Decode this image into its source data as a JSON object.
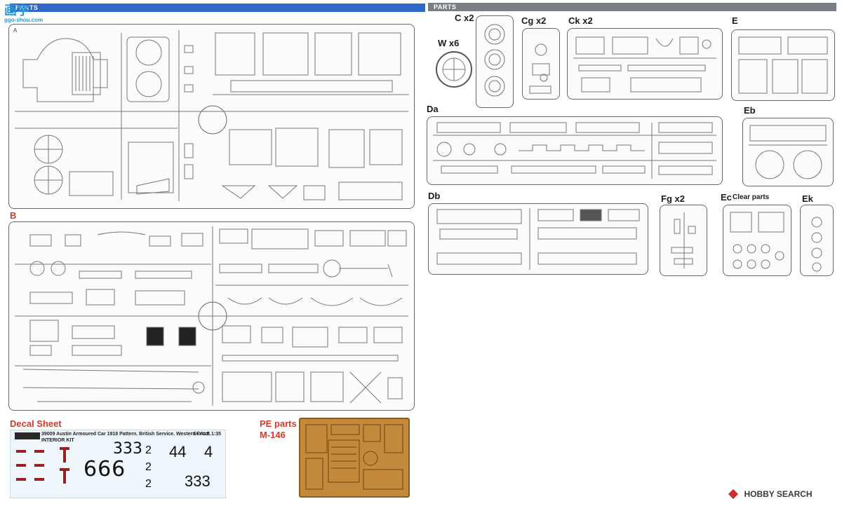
{
  "header_left": {
    "label": "PARTS"
  },
  "header_right": {
    "label": "PARTS"
  },
  "watermark_left": {
    "line1": "画字",
    "line2": "ggo-shou.com"
  },
  "sprues": {
    "A": {
      "label": "A"
    },
    "B": {
      "label": "B"
    },
    "C": {
      "label": "C x2"
    },
    "W": {
      "label": "W x6"
    },
    "Cg": {
      "label": "Cg x2"
    },
    "Ck": {
      "label": "Ck x2"
    },
    "E": {
      "label": "E"
    },
    "Da": {
      "label": "Da"
    },
    "Eb": {
      "label": "Eb"
    },
    "Db": {
      "label": "Db"
    },
    "Fg": {
      "label": "Fg x2"
    },
    "Ec": {
      "label": "Ec",
      "sub": "Clear parts"
    },
    "Ek": {
      "label": "Ek"
    }
  },
  "decal": {
    "title": "Decal Sheet",
    "header": "39009 Austin Armoured Car 1918 Pattern. British Service. Western Front.",
    "sub": "INTERIOR KIT",
    "scale": "SCALE 1:35",
    "numbers": [
      "666",
      "333",
      "2",
      "2",
      "2",
      "44",
      "4",
      "333"
    ]
  },
  "pe": {
    "title": "PE parts",
    "code": "M-146"
  },
  "watermark_right": {
    "text": "HOBBY SEARCH"
  },
  "colors": {
    "accent": "#2f68c8",
    "grey": "#7a7f86",
    "red": "#d23a2a",
    "pe": "#c48a3c"
  }
}
